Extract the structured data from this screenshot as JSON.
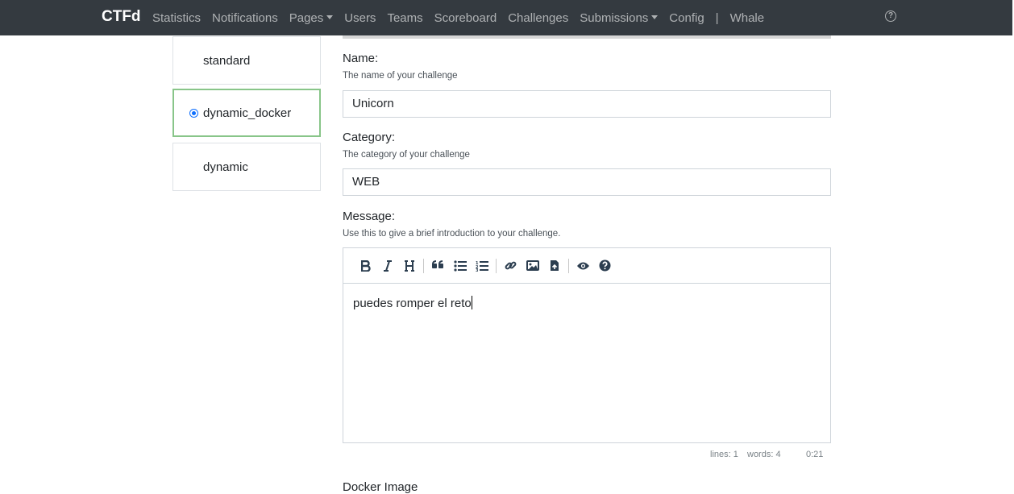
{
  "navbar": {
    "brand": "CTFd",
    "items": [
      {
        "label": "Statistics",
        "dropdown": false
      },
      {
        "label": "Notifications",
        "dropdown": false
      },
      {
        "label": "Pages",
        "dropdown": true
      },
      {
        "label": "Users",
        "dropdown": false
      },
      {
        "label": "Teams",
        "dropdown": false
      },
      {
        "label": "Scoreboard",
        "dropdown": false
      },
      {
        "label": "Challenges",
        "dropdown": false
      },
      {
        "label": "Submissions",
        "dropdown": true
      },
      {
        "label": "Config",
        "dropdown": false
      }
    ],
    "separator": "|",
    "plugin": "Whale",
    "help_icon": "?"
  },
  "challenge_types": [
    {
      "label": "standard",
      "selected": false
    },
    {
      "label": "dynamic_docker",
      "selected": true
    },
    {
      "label": "dynamic",
      "selected": false
    }
  ],
  "form": {
    "name": {
      "label": "Name:",
      "help": "The name of your challenge",
      "value": "Unicorn"
    },
    "category": {
      "label": "Category:",
      "help": "The category of your challenge",
      "value": "WEB"
    },
    "message": {
      "label": "Message:",
      "help": "Use this to give a brief introduction to your challenge.",
      "value": "puedes romper el reto"
    },
    "next_label": "Docker Image"
  },
  "editor": {
    "toolbar": [
      "bold-icon",
      "italic-icon",
      "heading-icon",
      "quote-icon",
      "unordered-list-icon",
      "ordered-list-icon",
      "link-icon",
      "image-icon",
      "upload-file-icon",
      "preview-icon",
      "help-icon"
    ],
    "status": {
      "lines": "lines: 1",
      "words": "words: 4",
      "time": "0:21"
    }
  },
  "colors": {
    "navbar": "#343a40",
    "selected_border": "#88c589",
    "radio": "#0d6efd"
  }
}
